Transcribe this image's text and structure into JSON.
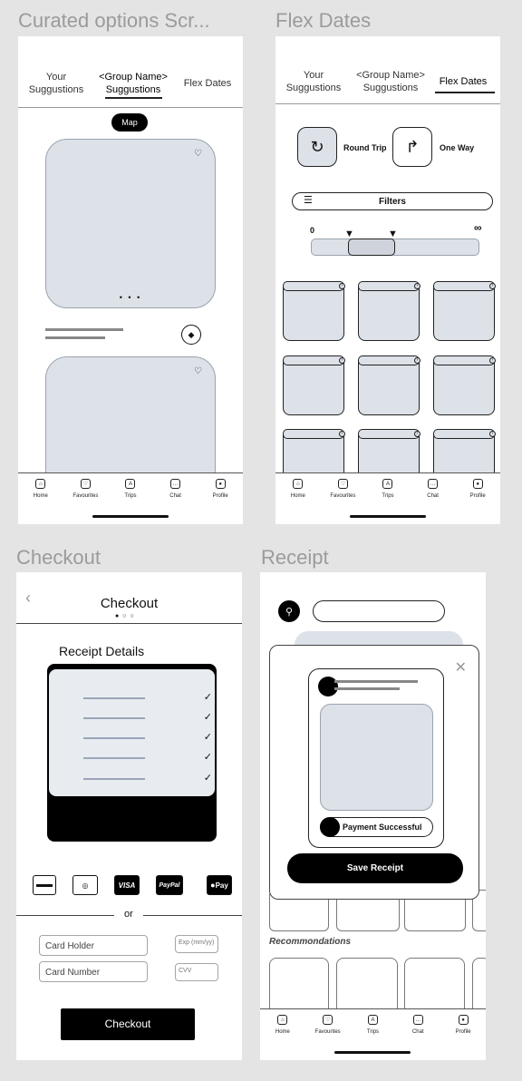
{
  "frames": {
    "curated": "Curated options Scr...",
    "flex": "Flex Dates",
    "checkout": "Checkout",
    "receipt": "Receipt"
  },
  "curated": {
    "tabs": [
      {
        "line1": "Your",
        "line2": "Suggustions"
      },
      {
        "line1": "<Group Name>",
        "line2": "Suggustions"
      },
      {
        "line1": "Flex Dates",
        "line2": ""
      }
    ],
    "map_label": "Map",
    "dots": "• • •"
  },
  "flex": {
    "tabs": [
      {
        "line1": "Your",
        "line2": "Suggustions"
      },
      {
        "line1": "<Group Name>",
        "line2": "Suggustions"
      },
      {
        "line1": "Flex Dates",
        "line2": ""
      }
    ],
    "round_trip": "Round Trip",
    "one_way": "One  Way",
    "filters": "Filters",
    "range_min": "0",
    "range_max": "∞"
  },
  "nav": [
    "Home",
    "Favourites",
    "Trips",
    "Chat",
    "Profile"
  ],
  "nav_icons": [
    "home-icon",
    "heart-icon",
    "trips-icon",
    "chat-icon",
    "profile-icon"
  ],
  "checkout": {
    "title": "Checkout",
    "receipt_details": "Receipt Details",
    "or": "or",
    "card_holder": "Card Holder",
    "card_number": "Card Number",
    "exp": "Exp (mm/yy)",
    "cvv": "CVV",
    "button": "Checkout",
    "pay_methods": [
      "card",
      "mastercard",
      "VISA",
      "PayPal",
      "Pay"
    ]
  },
  "receipt": {
    "payment_successful": "Payment Successful",
    "save_receipt": "Save Receipt",
    "recommendations": "Recommondations"
  }
}
